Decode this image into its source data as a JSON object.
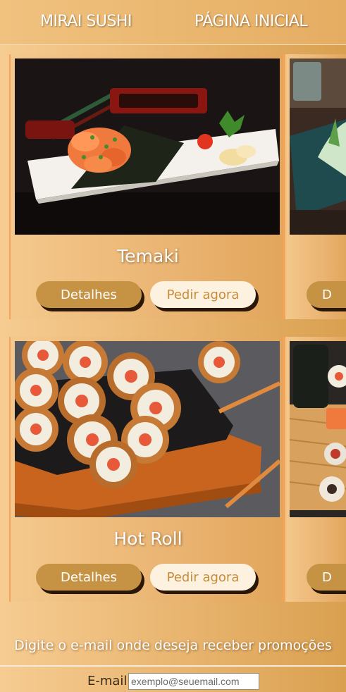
{
  "header": {
    "brand": "MIRAI SUSHI",
    "home_link": "PÁGINA INICIAL"
  },
  "cards": [
    {
      "title": "Temaki",
      "details_label": "Detalhes",
      "order_label": "Pedir agora"
    },
    {
      "title": "",
      "details_label": "D",
      "order_label": ""
    },
    {
      "title": "Hot Roll",
      "details_label": "Detalhes",
      "order_label": "Pedir agora"
    },
    {
      "title": "",
      "details_label": "D",
      "order_label": ""
    }
  ],
  "promo": {
    "text": "Digite o e-mail onde deseja receber promoções",
    "email_label": "E-mail:",
    "email_placeholder": "exemplo@seuemail.com"
  },
  "colors": {
    "details_button": "#c69244",
    "order_button": "#fdf1e0",
    "card_border": "#f3a45a"
  }
}
